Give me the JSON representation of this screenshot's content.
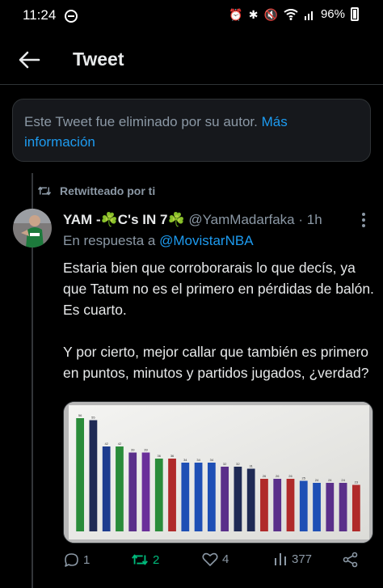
{
  "status_bar": {
    "time": "11:24",
    "battery": "96%"
  },
  "header": {
    "title": "Tweet"
  },
  "deleted_notice": {
    "text": "Este Tweet fue eliminado por su autor.",
    "link": "Más información"
  },
  "retweet_context": "Retwitteado por ti",
  "tweet": {
    "display_name": "YAM -☘️C's IN 7☘️",
    "handle": "@YamMadarfaka",
    "separator": "·",
    "time": "1h",
    "reply_prefix": "En respuesta a",
    "reply_to": "@MovistarNBA",
    "paragraph1": "Estaria bien que corroborarais lo que decís, ya que Tatum no es el primero en pérdidas de balón. Es cuarto.",
    "paragraph2": "Y por cierto, mejor callar que también es primero en puntos, minutos y partidos jugados, ¿verdad?"
  },
  "actions": {
    "replies": "1",
    "retweets": "2",
    "likes": "4",
    "views": "377"
  },
  "colors": {
    "link": "#1d9bf0",
    "retweet": "#00ba7c",
    "muted": "#8b98a5"
  },
  "chart_data": {
    "type": "bar",
    "values": [
      56,
      55,
      42,
      42,
      39,
      39,
      36,
      36,
      34,
      34,
      34,
      32,
      32,
      31,
      26,
      26,
      26,
      25,
      24,
      24,
      24,
      23
    ],
    "colors": [
      "#2a8c3a",
      "#1f2a55",
      "#1d3c8f",
      "#2a8c3a",
      "#5a2f8a",
      "#6a2f9a",
      "#2a8c3a",
      "#b02a2a",
      "#1e4fb5",
      "#1e4fb5",
      "#1e4fb5",
      "#5a2f8a",
      "#1f2a55",
      "#1f2a55",
      "#b02a2a",
      "#5a2f8a",
      "#b02a2a",
      "#1e4fb5",
      "#1e4fb5",
      "#5a2f8a",
      "#5a2f8a",
      "#b02a2a"
    ]
  }
}
